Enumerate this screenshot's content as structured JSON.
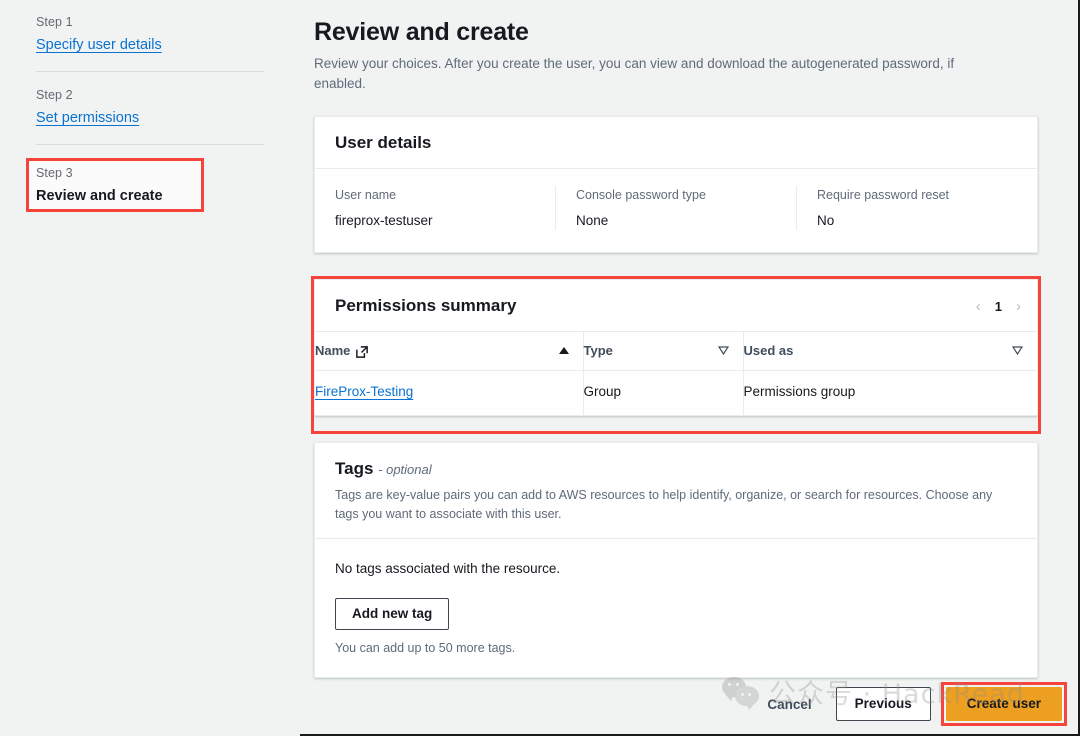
{
  "sidebar": {
    "steps": [
      {
        "num": "Step 1",
        "label": "Specify user details",
        "state": "link"
      },
      {
        "num": "Step 2",
        "label": "Set permissions",
        "state": "link"
      },
      {
        "num": "Step 3",
        "label": "Review and create",
        "state": "current"
      }
    ],
    "highlight_color": "#f4443c"
  },
  "page": {
    "title": "Review and create",
    "description": "Review your choices. After you create the user, you can view and download the autogenerated password, if enabled."
  },
  "user_details": {
    "title": "User details",
    "fields": [
      {
        "label": "User name",
        "value": "fireprox-testuser"
      },
      {
        "label": "Console password type",
        "value": "None"
      },
      {
        "label": "Require password reset",
        "value": "No"
      }
    ]
  },
  "permissions_summary": {
    "title": "Permissions summary",
    "pager": {
      "prev": "‹",
      "page": "1",
      "next": "›"
    },
    "columns": [
      {
        "label": "Name",
        "icon": "external-link-icon",
        "sort": "asc"
      },
      {
        "label": "Type",
        "sort": "none"
      },
      {
        "label": "Used as",
        "sort": "none"
      }
    ],
    "rows": [
      {
        "name": "FireProx-Testing",
        "type": "Group",
        "used_as": "Permissions group"
      }
    ],
    "highlight_color": "#f4443c"
  },
  "tags": {
    "title": "Tags",
    "optional_label": "- optional",
    "description": "Tags are key-value pairs you can add to AWS resources to help identify, organize, or search for resources. Choose any tags you want to associate with this user.",
    "empty_text": "No tags associated with the resource.",
    "add_button": "Add new tag",
    "hint": "You can add up to 50 more tags."
  },
  "footer": {
    "cancel": "Cancel",
    "previous": "Previous",
    "create": "Create user",
    "create_color": "#ec9f20",
    "highlight_color": "#f4443c"
  },
  "watermark": {
    "text": "公众号 · HackRead",
    "logo": "wechat-icon"
  }
}
